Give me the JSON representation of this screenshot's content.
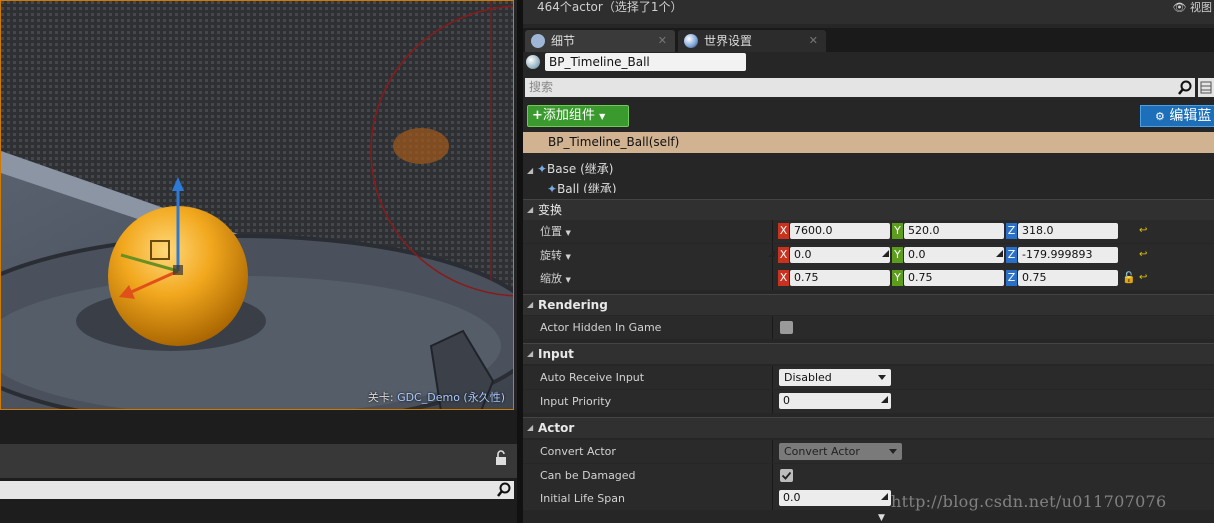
{
  "viewport": {
    "level_prefix": "关卡:",
    "level_name": "GDC_Demo (永久性)"
  },
  "outliner": {
    "actor_count": "464个actor（选择了1个）",
    "view_options": "视图"
  },
  "tabs": [
    {
      "label": "细节",
      "close": "✕"
    },
    {
      "label": "世界设置",
      "close": "✕"
    }
  ],
  "details": {
    "actor_name": "BP_Timeline_Ball",
    "search_placeholder": "搜索",
    "add_component_label": "添加组件",
    "edit_blueprint_label": "编辑蓝",
    "self_label": "BP_Timeline_Ball(self)",
    "tree": [
      {
        "label": "Base (继承)"
      },
      {
        "label": "Ball (继承)"
      }
    ]
  },
  "transform": {
    "category": "变换",
    "location": {
      "label": "位置",
      "x": "7600.0",
      "y": "520.0",
      "z": "318.0"
    },
    "rotation": {
      "label": "旋转",
      "x": "0.0",
      "y": "0.0",
      "z": "-179.999893"
    },
    "scale": {
      "label": "缩放",
      "x": "0.75",
      "y": "0.75",
      "z": "0.75"
    }
  },
  "rendering": {
    "category": "Rendering",
    "actor_hidden_label": "Actor Hidden In Game",
    "actor_hidden": false
  },
  "input": {
    "category": "Input",
    "auto_receive_label": "Auto Receive Input",
    "auto_receive_value": "Disabled",
    "priority_label": "Input Priority",
    "priority_value": "0"
  },
  "actor": {
    "category": "Actor",
    "convert_label": "Convert Actor",
    "convert_value": "Convert Actor",
    "damaged_label": "Can be Damaged",
    "damaged": true,
    "life_span_label": "Initial Life Span",
    "life_span_value": "0.0"
  },
  "watermark": "http://blog.csdn.net/u011707076",
  "colors": {
    "axis_x": "#c8321e",
    "axis_y": "#5c9d1e",
    "axis_z": "#2a6fc8",
    "add_component": "#3a9a2e",
    "edit_blueprint": "#1c6fb8",
    "selection": "#d1b291",
    "viewport_border": "#d07a00"
  }
}
